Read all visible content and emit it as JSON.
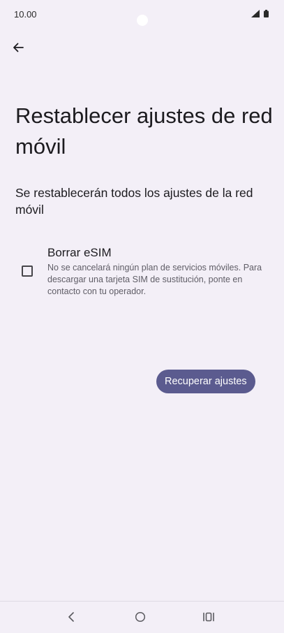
{
  "status_bar": {
    "time": "10.00",
    "icons": [
      "signal-icon",
      "battery-icon"
    ]
  },
  "toolbar": {
    "back_icon": "arrow-left-icon"
  },
  "page": {
    "title": "Restablecer ajustes de red móvil",
    "description": "Se restablecerán todos los ajustes de la red móvil"
  },
  "option": {
    "checked": false,
    "title": "Borrar eSIM",
    "summary": "No se cancelará ningún plan de servicios móviles. Para descargar una tarjeta SIM de sustitución, ponte en contacto con tu operador."
  },
  "actions": {
    "reset_label": "Recuperar ajustes"
  },
  "navigation_bar": {
    "items": [
      "back-icon",
      "home-icon",
      "recents-icon"
    ]
  },
  "colors": {
    "background": "#f3eff7",
    "primary_button": "#5b5b8f",
    "text_primary": "#1c1b1f",
    "text_secondary": "#5f5d66"
  }
}
